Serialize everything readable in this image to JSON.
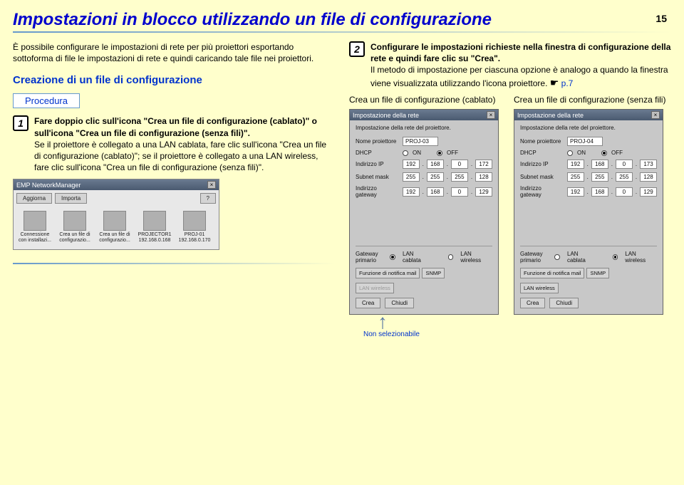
{
  "page": {
    "title": "Impostazioni in blocco utilizzando un file di configurazione",
    "number": "15"
  },
  "left": {
    "intro": "È possibile configurare le impostazioni di rete per più proiettori esportando sottoforma di file le impostazioni di rete e quindi caricando tale file nei proiettori.",
    "subhead": "Creazione di un file di configurazione",
    "procedura": "Procedura",
    "step1": {
      "num": "1",
      "bold": "Fare doppio clic sull'icona \"Crea un file di configurazione (cablato)\" o sull'icona \"Crea un file di configurazione (senza fili)\".",
      "text": "Se il proiettore è collegato a una LAN cablata, fare clic sull'icona \"Crea un file di configurazione (cablato)\"; se il proiettore è collegato a una LAN wireless, fare clic sull'icona \"Crea un file di configurazione (senza fili)\"."
    },
    "nm": {
      "title": "EMP NetworkManager",
      "close": "×",
      "aggiorna": "Aggiorna",
      "importa": "Importa",
      "help": "?",
      "icons": [
        {
          "l1": "Connessione",
          "l2": "con installazi..."
        },
        {
          "l1": "Crea un file di",
          "l2": "configurazio..."
        },
        {
          "l1": "Crea un file di",
          "l2": "configurazio..."
        },
        {
          "l1": "PROJECTOR1",
          "l2": "192.168.0.168"
        },
        {
          "l1": "PROJ-01",
          "l2": "192.168.0.170"
        }
      ]
    }
  },
  "right": {
    "step2": {
      "num": "2",
      "bold": "Configurare le impostazioni richieste nella finestra di configurazione della rete e quindi fare clic su \"Crea\".",
      "text_a": "Il metodo di impostazione per ciascuna opzione è analogo a quando la finestra viene visualizzata utilizzando l'icona proiettore. ",
      "hand": "☛",
      "link": "p.7"
    },
    "cap_wired": "Crea un file di configurazione (cablato)",
    "cap_wireless": "Crea un file di configurazione (senza fili)",
    "lbl": {
      "hint": "Impostazione della rete del proiettore.",
      "nome": "Nome proiettore",
      "dhcp": "DHCP",
      "on": "ON",
      "off": "OFF",
      "ip": "Indirizzo IP",
      "mask": "Subnet mask",
      "gw": "Indirizzo gateway",
      "gwprim": "Gateway primario",
      "lan_cab": "LAN cablata",
      "lan_wl": "LAN wireless",
      "mail": "Funzione di notifica mail",
      "snmp": "SNMP",
      "lan_wireless_box": "LAN wireless",
      "crea": "Crea",
      "chiudi": "Chiudi"
    },
    "wired": {
      "title": "Impostazione della rete",
      "name": "PROJ-03",
      "ip": [
        "192",
        "168",
        "0",
        "172"
      ],
      "mask": [
        "255",
        "255",
        "255",
        "128"
      ],
      "gw": [
        "192",
        "168",
        "0",
        "129"
      ]
    },
    "wireless": {
      "title": "Impostazione della rete",
      "name": "PROJ-04",
      "ip": [
        "192",
        "168",
        "0",
        "173"
      ],
      "mask": [
        "255",
        "255",
        "255",
        "128"
      ],
      "gw": [
        "192",
        "168",
        "0",
        "129"
      ]
    },
    "non_sel": "Non selezionabile"
  }
}
